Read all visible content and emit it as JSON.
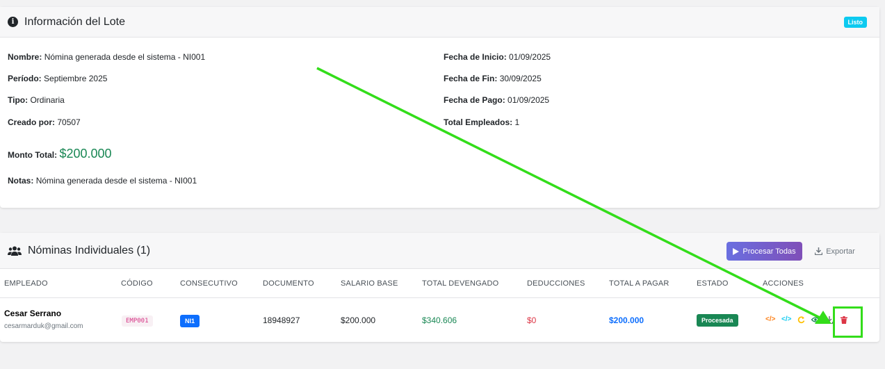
{
  "lote": {
    "title": "Información del Lote",
    "badge": "Listo",
    "nombre_label": "Nombre:",
    "nombre_value": "Nómina generada desde el sistema - NI001",
    "periodo_label": "Período:",
    "periodo_value": "Septiembre 2025",
    "tipo_label": "Tipo:",
    "tipo_value": "Ordinaria",
    "creado_label": "Creado por:",
    "creado_value": "70507",
    "monto_label": "Monto Total:",
    "monto_value": "$200.000",
    "notas_label": "Notas:",
    "notas_value": "Nómina generada desde el sistema - NI001",
    "inicio_label": "Fecha de Inicio:",
    "inicio_value": "01/09/2025",
    "fin_label": "Fecha de Fin:",
    "fin_value": "30/09/2025",
    "pago_label": "Fecha de Pago:",
    "pago_value": "01/09/2025",
    "total_emp_label": "Total Empleados:",
    "total_emp_value": "1"
  },
  "nominas": {
    "title": "Nóminas Individuales (1)",
    "procesar_label": "Procesar Todas",
    "exportar_label": "Exportar",
    "columns": [
      "EMPLEADO",
      "CÓDIGO",
      "CONSECUTIVO",
      "DOCUMENTO",
      "SALARIO BASE",
      "TOTAL DEVENGADO",
      "DEDUCCIONES",
      "TOTAL A PAGAR",
      "ESTADO",
      "ACCIONES"
    ],
    "rows": [
      {
        "nombre": "Cesar Serrano",
        "email": "cesarmarduk@gmail.com",
        "codigo": "EMP001",
        "consecutivo": "NI1",
        "documento": "18948927",
        "salario_base": "$200.000",
        "total_devengado": "$340.606",
        "deducciones": "$0",
        "total_pagar": "$200.000",
        "estado": "Procesada"
      }
    ]
  },
  "colors": {
    "accent_green": "#198754",
    "accent_blue": "#0d6efd",
    "danger": "#dc3545",
    "info": "#0dcaf0",
    "annotation": "#33dd1a"
  },
  "icons": [
    "info-icon",
    "users-icon",
    "play-icon",
    "download-icon",
    "code-icon",
    "refresh-icon",
    "eye-icon",
    "trash-icon"
  ]
}
